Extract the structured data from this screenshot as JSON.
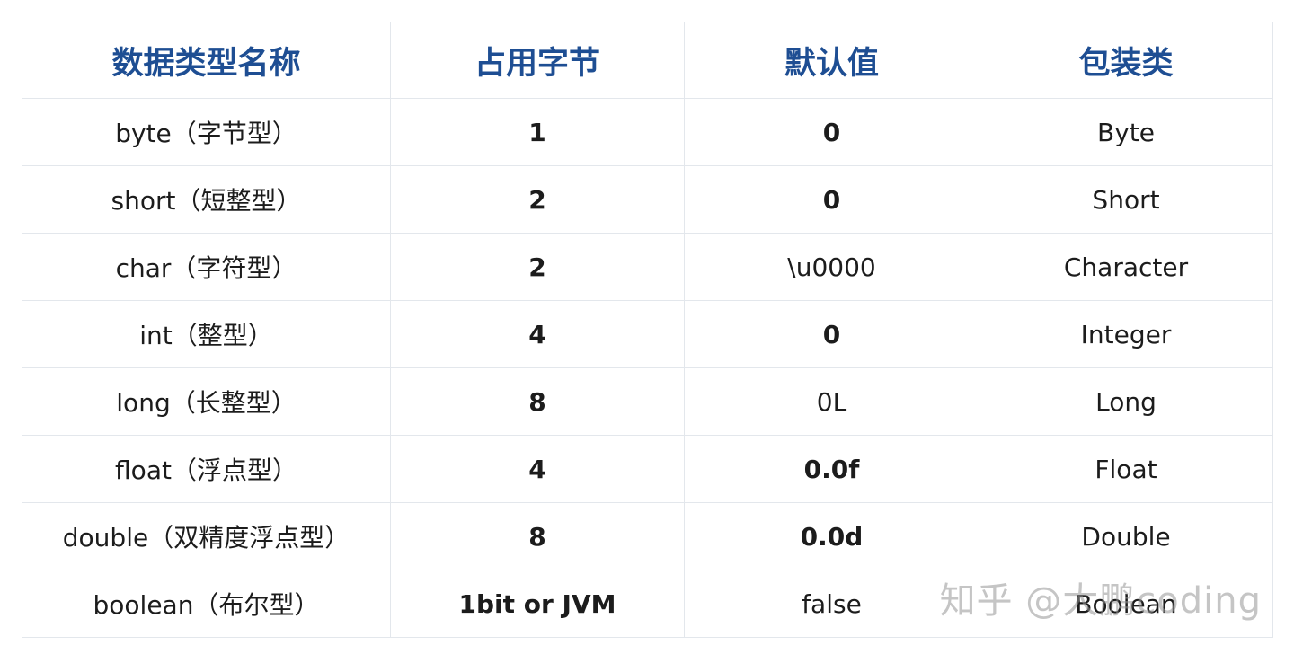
{
  "table": {
    "headers": [
      "数据类型名称",
      "占用字节",
      "默认值",
      "包装类"
    ],
    "rows": [
      [
        "byte（字节型）",
        "1",
        "0",
        "Byte"
      ],
      [
        "short（短整型）",
        "2",
        "0",
        "Short"
      ],
      [
        "char（字符型）",
        "2",
        "\\u0000",
        "Character"
      ],
      [
        "int（整型）",
        "4",
        "0",
        "Integer"
      ],
      [
        "long（长整型）",
        "8",
        "0L",
        "Long"
      ],
      [
        "float（浮点型）",
        "4",
        "0.0f",
        "Float"
      ],
      [
        "double（双精度浮点型）",
        "8",
        "0.0d",
        "Double"
      ],
      [
        "boolean（布尔型）",
        "1bit or JVM",
        "false",
        "Boolean"
      ]
    ]
  },
  "watermark": "知乎 @大鹏coding",
  "colors": {
    "header_text": "#1e4e93",
    "body_text": "#1c1c1c",
    "border": "#e3e7ec"
  }
}
